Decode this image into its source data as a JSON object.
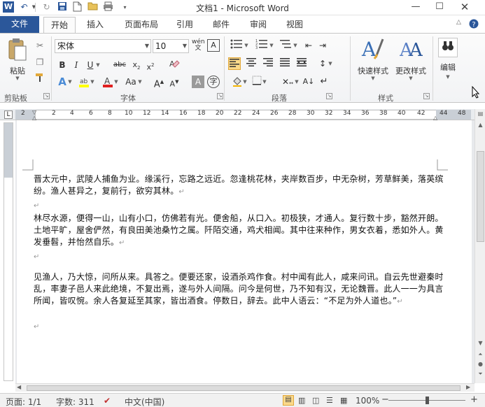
{
  "title_bar": {
    "logo": "W",
    "title": "文档1 - Microsoft Word"
  },
  "tabs": [
    {
      "label": "文件"
    },
    {
      "label": "开始"
    },
    {
      "label": "插入"
    },
    {
      "label": "页面布局"
    },
    {
      "label": "引用"
    },
    {
      "label": "邮件"
    },
    {
      "label": "审阅"
    },
    {
      "label": "视图"
    }
  ],
  "ribbon": {
    "paste_label": "粘贴",
    "clipboard_group": "剪贴板",
    "font_name": "宋体",
    "font_size": "10",
    "font_group": "字体",
    "paragraph_group": "段落",
    "quick_style_label": "快速样式",
    "change_style_label": "更改样式",
    "styles_group": "样式",
    "edit_label": "编辑"
  },
  "ruler": {
    "numbers": [
      "2",
      "2",
      "4",
      "6",
      "8",
      "10",
      "12",
      "14",
      "16",
      "18",
      "20",
      "22",
      "24",
      "26",
      "28",
      "30",
      "32",
      "34",
      "36",
      "38",
      "40",
      "42",
      "44",
      "48"
    ]
  },
  "document": {
    "paragraphs": [
      "晋太元中，武陵人捕鱼为业。缘溪行，忘路之远近。忽逢桃花林，夹岸数百步，中无杂树，芳草鲜美，落英缤纷。渔人甚异之，复前行，欲穷其林。",
      "",
      "林尽水源，便得一山，山有小口，仿佛若有光。便舍船，从口入。初极狭，才通人。复行数十步，豁然开朗。土地平旷，屋舍俨然，有良田美池桑竹之属。阡陌交通，鸡犬相闻。其中往来种作，男女衣着，悉如外人。黄发垂髫，并怡然自乐。",
      "",
      "见渔人，乃大惊，问所从来。具答之。便要还家，设酒杀鸡作食。村中闻有此人，咸来问讯。自云先世避秦时乱，率妻子邑人来此绝境，不复出焉，遂与外人间隔。问今是何世，乃不知有汉，无论魏晋。此人一一为具言所闻，皆叹惋。余人各复延至其家，皆出酒食。停数日，辞去。此中人语云：“不足为外人道也。”",
      ""
    ],
    "para_mark": "↵"
  },
  "status_bar": {
    "page": "页面: 1/1",
    "words": "字数: 311",
    "language": "中文(中国)",
    "zoom": "100%"
  }
}
